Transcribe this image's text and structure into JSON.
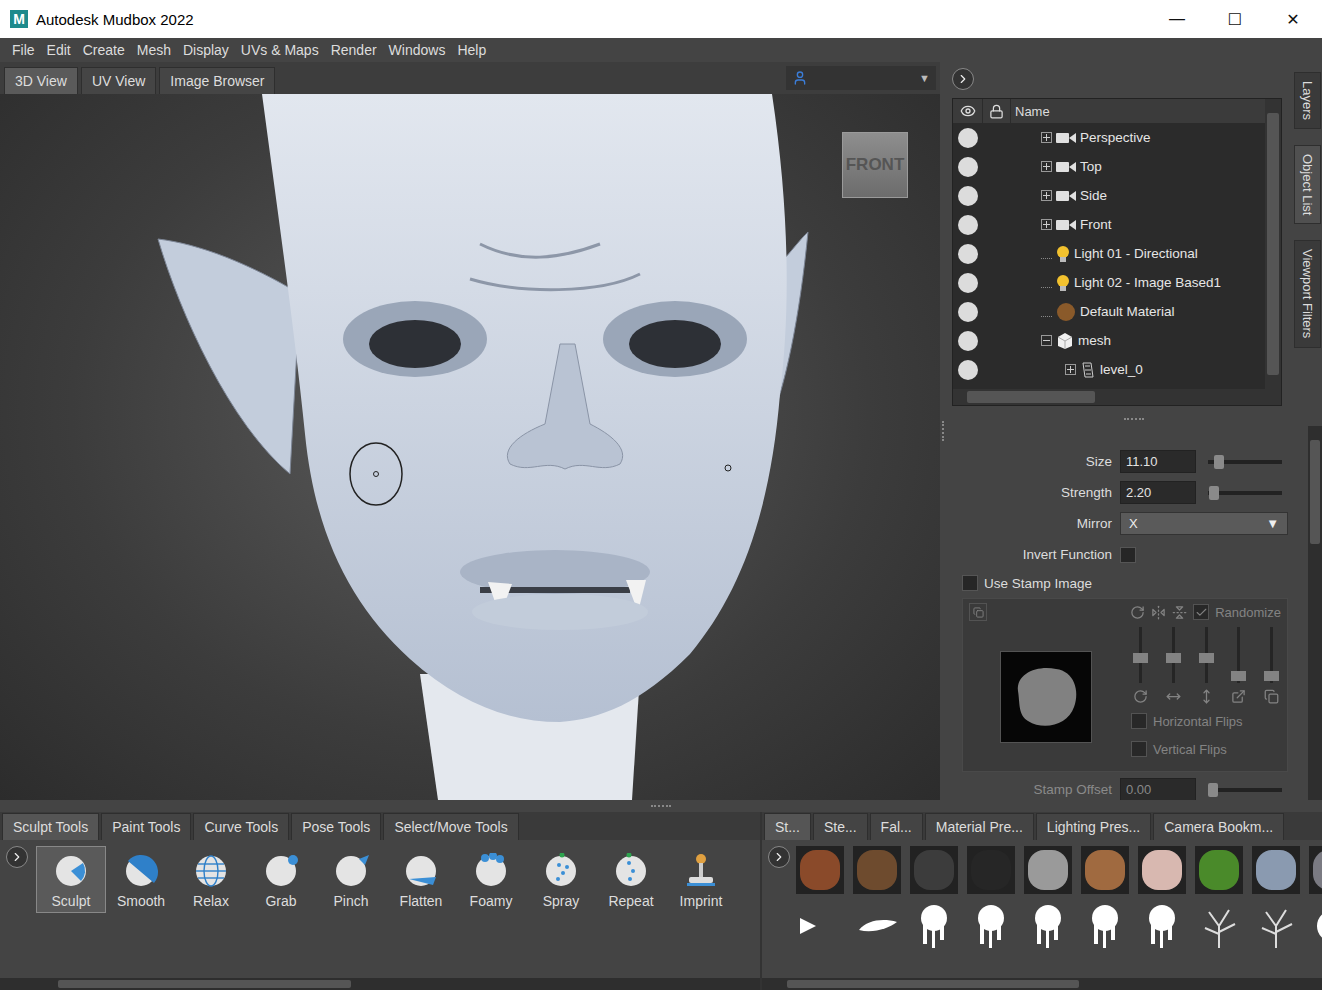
{
  "window": {
    "title": "Autodesk Mudbox 2022",
    "logo": "M",
    "controls": [
      "—",
      "☐",
      "✕"
    ]
  },
  "menu": [
    "File",
    "Edit",
    "Create",
    "Mesh",
    "Display",
    "UVs & Maps",
    "Render",
    "Windows",
    "Help"
  ],
  "view_tabs": [
    {
      "label": "3D View",
      "selected": true
    },
    {
      "label": "UV View",
      "selected": false
    },
    {
      "label": "Image Browser",
      "selected": false
    }
  ],
  "camera_dropdown": {
    "arrow": "▼"
  },
  "viewport": {
    "view_cube": "FRONT"
  },
  "side_tabs": [
    {
      "label": "Layers",
      "selected": false
    },
    {
      "label": "Object List",
      "selected": true
    },
    {
      "label": "Viewport Filters",
      "selected": false
    }
  ],
  "object_list": {
    "column": "Name",
    "rows": [
      {
        "name": "Perspective",
        "kind": "camera",
        "visible": true,
        "expandable": true,
        "expanded": false,
        "children": []
      },
      {
        "name": "Top",
        "kind": "camera",
        "visible": true,
        "expandable": true,
        "expanded": false,
        "children": []
      },
      {
        "name": "Side",
        "kind": "camera",
        "visible": true,
        "expandable": true,
        "expanded": false,
        "children": []
      },
      {
        "name": "Front",
        "kind": "camera",
        "visible": true,
        "expandable": true,
        "expanded": false,
        "children": []
      },
      {
        "name": "Light 01 - Directional",
        "kind": "light",
        "visible": true,
        "expandable": false,
        "expanded": false,
        "children": []
      },
      {
        "name": "Light 02 - Image Based1",
        "kind": "light",
        "visible": true,
        "expandable": false,
        "expanded": false,
        "children": []
      },
      {
        "name": "Default Material",
        "kind": "material",
        "visible": true,
        "expandable": false,
        "expanded": false,
        "children": []
      },
      {
        "name": "mesh",
        "kind": "mesh",
        "visible": true,
        "expandable": true,
        "expanded": true,
        "children": [
          {
            "name": "level_0",
            "kind": "layer",
            "visible": true,
            "expandable": true,
            "expanded": false,
            "children": []
          }
        ]
      }
    ]
  },
  "properties": {
    "fields": [
      {
        "label": "Size",
        "value": "11.10",
        "kind": "slider",
        "level": 0.15
      },
      {
        "label": "Strength",
        "value": "2.20",
        "kind": "slider",
        "level": 0.08
      },
      {
        "label": "Mirror",
        "value": "X",
        "kind": "dropdown",
        "arrow": "▼"
      },
      {
        "label": "Invert Function",
        "kind": "checkbox",
        "checked": false
      }
    ],
    "use_stamp": {
      "label": "Use Stamp Image",
      "checked": false
    },
    "stamp": {
      "disabled": true,
      "randomize": {
        "label": "Randomize",
        "checked": true
      },
      "sliders": [
        {
          "level": 0.45
        },
        {
          "level": 0.45
        },
        {
          "level": 0.45
        },
        {
          "level": 0.12
        },
        {
          "level": 0.12
        }
      ],
      "flips": [
        {
          "label": "Horizontal Flips",
          "checked": false
        },
        {
          "label": "Vertical Flips",
          "checked": false
        }
      ]
    },
    "offset": {
      "label": "Stamp Offset",
      "value": "0.00",
      "level": 0.0
    }
  },
  "tool_tabs": [
    {
      "label": "Sculpt Tools",
      "selected": true
    },
    {
      "label": "Paint Tools",
      "selected": false
    },
    {
      "label": "Curve Tools",
      "selected": false
    },
    {
      "label": "Pose Tools",
      "selected": false
    },
    {
      "label": "Select/Move Tools",
      "selected": false
    }
  ],
  "tools": [
    {
      "label": "Sculpt",
      "selected": true
    },
    {
      "label": "Smooth",
      "selected": false
    },
    {
      "label": "Relax",
      "selected": false
    },
    {
      "label": "Grab",
      "selected": false
    },
    {
      "label": "Pinch",
      "selected": false
    },
    {
      "label": "Flatten",
      "selected": false
    },
    {
      "label": "Foamy",
      "selected": false
    },
    {
      "label": "Spray",
      "selected": false
    },
    {
      "label": "Repeat",
      "selected": false
    },
    {
      "label": "Imprint",
      "selected": false
    }
  ],
  "library_tabs": [
    {
      "label": "St...",
      "selected": true
    },
    {
      "label": "Ste...",
      "selected": false
    },
    {
      "label": "Fal...",
      "selected": false
    },
    {
      "label": "Material Pre...",
      "selected": false
    },
    {
      "label": "Lighting Pres...",
      "selected": false
    },
    {
      "label": "Camera Bookm...",
      "selected": false
    }
  ],
  "stamps": [
    {
      "color": "#8a4a2a"
    },
    {
      "color": "#6e4b2e"
    },
    {
      "color": "#3c3c3c"
    },
    {
      "color": "#262626"
    },
    {
      "color": "#9a9a9a"
    },
    {
      "color": "#a06a40"
    },
    {
      "color": "#d8b8b0"
    },
    {
      "color": "#4a8a2a"
    },
    {
      "color": "#8a9ab0"
    },
    {
      "color": "#7a7a82"
    }
  ],
  "brushes": [
    {
      "kind": "arrow"
    },
    {
      "kind": "smear"
    },
    {
      "kind": "drip"
    },
    {
      "kind": "drip"
    },
    {
      "kind": "drip"
    },
    {
      "kind": "drip"
    },
    {
      "kind": "drip"
    },
    {
      "kind": "branch"
    },
    {
      "kind": "branch"
    },
    {
      "kind": "blob"
    }
  ]
}
